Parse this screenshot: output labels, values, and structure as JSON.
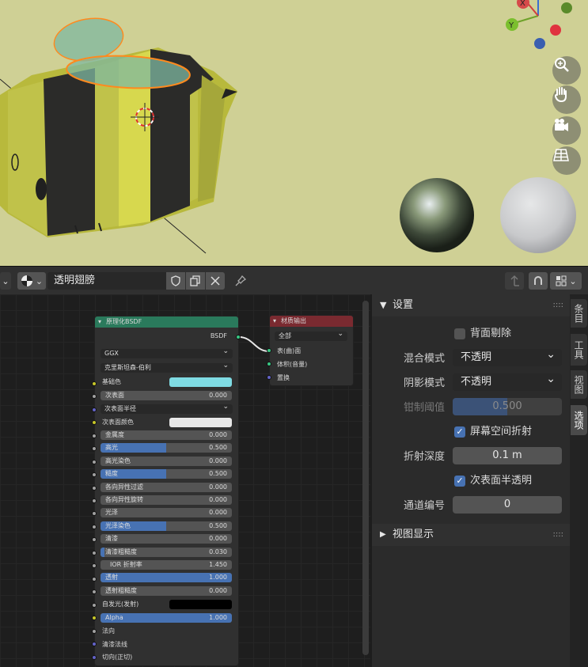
{
  "viewport": {
    "gizmo": {
      "x_label": "X",
      "y_label": "Y"
    },
    "nav_icons": [
      "zoom-icon",
      "hand-icon",
      "camera-icon",
      "grid-icon"
    ]
  },
  "header": {
    "material_name": "透明翅膀",
    "colors": {
      "bg": "#303030",
      "field": "#282828"
    }
  },
  "node_principled": {
    "title": "原理化BSDF",
    "output_label": "BSDF",
    "distribution": "GGX",
    "subsurface_method": "克里斯坦森-伯利",
    "base_color_label": "基础色",
    "base_color": "#7fdbe3",
    "subsurface_label": "次表面",
    "subsurface_value": "0.000",
    "subsurface_radius_label": "次表面半径",
    "subsurface_color_label": "次表面颜色",
    "subsurface_color": "#e8e8e8",
    "fields": [
      {
        "label": "金属度",
        "value": "0.000",
        "fill": 0
      },
      {
        "label": "高光",
        "value": "0.500",
        "fill": 0.5
      },
      {
        "label": "高光染色",
        "value": "0.000",
        "fill": 0
      },
      {
        "label": "糙度",
        "value": "0.500",
        "fill": 0.5
      },
      {
        "label": "各向异性过滤",
        "value": "0.000",
        "fill": 0
      },
      {
        "label": "各向异性旋转",
        "value": "0.000",
        "fill": 0
      },
      {
        "label": "光泽",
        "value": "0.000",
        "fill": 0
      },
      {
        "label": "光泽染色",
        "value": "0.500",
        "fill": 0.5
      },
      {
        "label": "清漆",
        "value": "0.000",
        "fill": 0
      },
      {
        "label": "清漆粗糙度",
        "value": "0.030",
        "fill": 0.03
      },
      {
        "label": "IOR 折射率",
        "value": "1.450",
        "fill": 0
      },
      {
        "label": "透射",
        "value": "1.000",
        "fill": 1
      },
      {
        "label": "透射粗糙度",
        "value": "0.000",
        "fill": 0
      }
    ],
    "emission_label": "自发光(发射)",
    "emission_color": "#000000",
    "alpha_label": "Alpha",
    "alpha_value": "1.000",
    "normal_label": "法向",
    "clearcoat_normal_label": "清漆法线",
    "tangent_label": "切向(正切)"
  },
  "node_output": {
    "title": "材质输出",
    "target": "全部",
    "inputs": [
      "表(曲)面",
      "体积(音量)",
      "置换"
    ]
  },
  "props": {
    "settings_title": "设置",
    "backface_label": "背面剔除",
    "backface_checked": false,
    "blend_label": "混合模式",
    "blend_value": "不透明",
    "shadow_label": "阴影模式",
    "shadow_value": "不透明",
    "clip_label": "钳制阈值",
    "clip_value": "0.500",
    "ssr_label": "屏幕空间折射",
    "ssr_checked": true,
    "refraction_depth_label": "折射深度",
    "refraction_depth_value": "0.1 m",
    "sss_translucency_label": "次表面半透明",
    "sss_checked": true,
    "pass_index_label": "通道编号",
    "pass_index_value": "0",
    "viewport_display_label": "视图显示"
  },
  "side_tabs": [
    "条目",
    "工具",
    "视图",
    "选项"
  ],
  "colors": {
    "accent": "#4772b3",
    "shader_header": "#2a7a5c",
    "output_header": "#7a2a30"
  }
}
